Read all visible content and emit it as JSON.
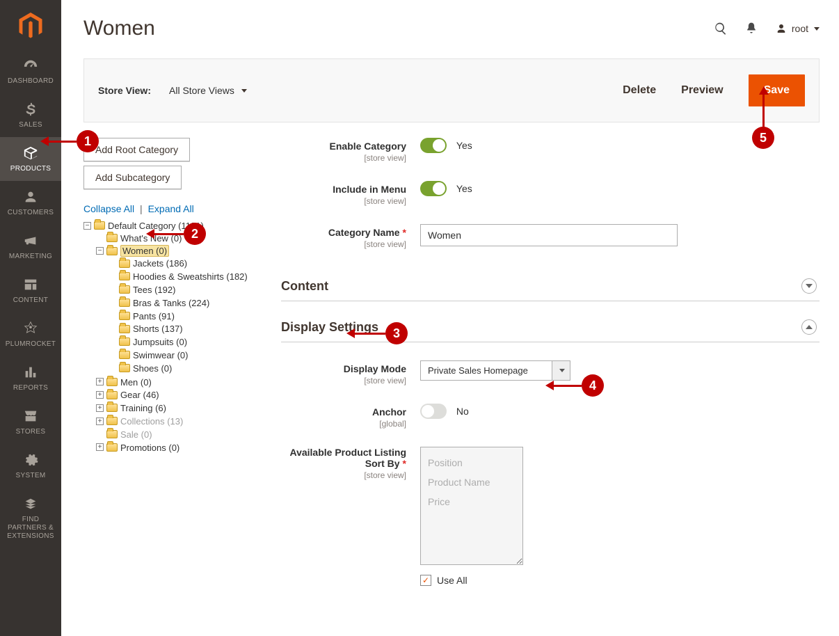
{
  "page": {
    "title": "Women",
    "user": "root"
  },
  "sidebar": {
    "items": [
      {
        "label": "DASHBOARD"
      },
      {
        "label": "SALES"
      },
      {
        "label": "PRODUCTS"
      },
      {
        "label": "CUSTOMERS"
      },
      {
        "label": "MARKETING"
      },
      {
        "label": "CONTENT"
      },
      {
        "label": "PLUMROCKET"
      },
      {
        "label": "REPORTS"
      },
      {
        "label": "STORES"
      },
      {
        "label": "SYSTEM"
      },
      {
        "label": "FIND PARTNERS & EXTENSIONS"
      }
    ]
  },
  "toolbar": {
    "store_view_label": "Store View:",
    "store_view_value": "All Store Views",
    "delete": "Delete",
    "preview": "Preview",
    "save": "Save"
  },
  "tree": {
    "add_root_btn": "Add Root Category",
    "add_sub_btn": "Add Subcategory",
    "collapse": "Collapse All",
    "expand": "Expand All",
    "nodes": {
      "root": "Default Category (1181)",
      "whatsnew": "What's New (0)",
      "women": "Women (0)",
      "jackets": "Jackets (186)",
      "hoodies": "Hoodies & Sweatshirts (182)",
      "tees": "Tees (192)",
      "bras": "Bras & Tanks (224)",
      "pants": "Pants (91)",
      "shorts": "Shorts (137)",
      "jumpsuits": "Jumpsuits (0)",
      "swimwear": "Swimwear (0)",
      "shoes": "Shoes (0)",
      "men": "Men (0)",
      "gear": "Gear (46)",
      "training": "Training (6)",
      "collections": "Collections (13)",
      "sale": "Sale (0)",
      "promotions": "Promotions (0)"
    }
  },
  "form": {
    "enable_label": "Enable Category",
    "enable_scope": "[store view]",
    "enable_value": "Yes",
    "include_label": "Include in Menu",
    "include_scope": "[store view]",
    "include_value": "Yes",
    "name_label": "Category Name",
    "name_scope": "[store view]",
    "name_value": "Women"
  },
  "sections": {
    "content": "Content",
    "display": "Display Settings"
  },
  "display": {
    "mode_label": "Display Mode",
    "mode_scope": "[store view]",
    "mode_value": "Private Sales Homepage",
    "anchor_label": "Anchor",
    "anchor_scope": "[global]",
    "anchor_value": "No",
    "sort_label": "Available Product Listing Sort By",
    "sort_scope": "[store view]",
    "sort_options": [
      "Position",
      "Product Name",
      "Price"
    ],
    "useall_label": "Use All"
  },
  "annotations": {
    "n1": "1",
    "n2": "2",
    "n3": "3",
    "n4": "4",
    "n5": "5"
  }
}
